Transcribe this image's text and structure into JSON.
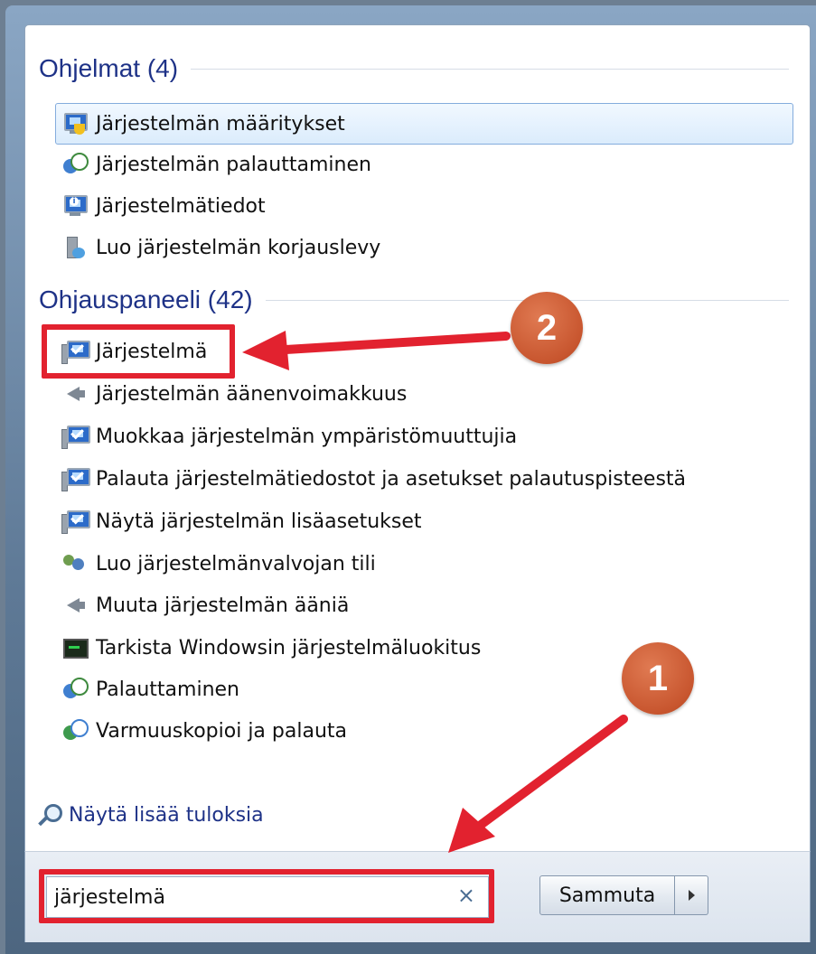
{
  "sections": [
    {
      "title": "Ohjelmat (4)",
      "items": [
        {
          "label": "Järjestelmän määritykset",
          "icon": "system-configuration-icon",
          "selected": true
        },
        {
          "label": "Järjestelmän palauttaminen",
          "icon": "system-restore-icon"
        },
        {
          "label": "Järjestelmätiedot",
          "icon": "system-information-icon"
        },
        {
          "label": "Luo järjestelmän korjauslevy",
          "icon": "repair-disc-icon"
        }
      ]
    },
    {
      "title": "Ohjauspaneeli (42)",
      "items": [
        {
          "label": "Järjestelmä",
          "icon": "system-monitor-icon"
        },
        {
          "label": "Järjestelmän äänenvoimakkuus",
          "icon": "speaker-icon"
        },
        {
          "label": "Muokkaa järjestelmän ympäristömuuttujia",
          "icon": "system-monitor-icon"
        },
        {
          "label": "Palauta järjestelmätiedostot ja asetukset palautuspisteestä",
          "icon": "system-monitor-icon"
        },
        {
          "label": "Näytä järjestelmän lisäasetukset",
          "icon": "system-monitor-icon"
        },
        {
          "label": "Luo järjestelmänvalvojan tili",
          "icon": "users-icon"
        },
        {
          "label": "Muuta järjestelmän ääniä",
          "icon": "speaker-icon"
        },
        {
          "label": "Tarkista Windowsin järjestelmäluokitus",
          "icon": "performance-icon"
        },
        {
          "label": "Palauttaminen",
          "icon": "recovery-icon"
        },
        {
          "label": "Varmuuskopioi ja palauta",
          "icon": "backup-restore-icon"
        }
      ]
    }
  ],
  "see_more": "Näytä lisää tuloksia",
  "search": {
    "value": "järjestelmä",
    "clear": "×"
  },
  "shutdown": {
    "label": "Sammuta"
  },
  "annotations": {
    "badge1": "1",
    "badge2": "2"
  },
  "colors": {
    "highlight_red": "#e2222f",
    "badge_orange": "#c8562f",
    "heading_blue": "#1e3287"
  }
}
